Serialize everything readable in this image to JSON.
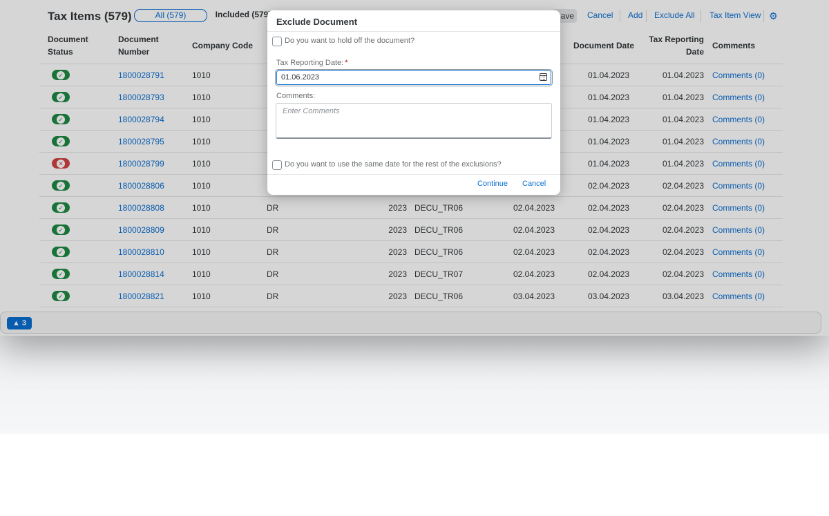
{
  "toolbar": {
    "title": "Tax Items (579)",
    "seg_all": "All (579)",
    "seg_included": "Included (579)",
    "save": "Save",
    "cancel": "Cancel",
    "add": "Add",
    "exclude_all": "Exclude All",
    "tax_item_view": "Tax Item View"
  },
  "columns": {
    "doc_status_1": "Document",
    "doc_status_2": "Status",
    "doc_number_1": "Document",
    "doc_number_2": "Number",
    "company_code": "Company Code",
    "document_date": "Document Date",
    "tax_reporting_1": "Tax Reporting",
    "tax_reporting_2": "Date",
    "comments": "Comments"
  },
  "rows": [
    {
      "status": "ok",
      "number": "1800028791",
      "company": "1010",
      "type": "",
      "year": "",
      "code": "",
      "posting": "",
      "doc_date": "01.04.2023",
      "tax_date": "01.04.2023",
      "comments": "Comments (0)"
    },
    {
      "status": "ok",
      "number": "1800028793",
      "company": "1010",
      "type": "",
      "year": "",
      "code": "",
      "posting": "",
      "doc_date": "01.04.2023",
      "tax_date": "01.04.2023",
      "comments": "Comments (0)"
    },
    {
      "status": "ok",
      "number": "1800028794",
      "company": "1010",
      "type": "",
      "year": "",
      "code": "",
      "posting": "",
      "doc_date": "01.04.2023",
      "tax_date": "01.04.2023",
      "comments": "Comments (0)"
    },
    {
      "status": "ok",
      "number": "1800028795",
      "company": "1010",
      "type": "",
      "year": "",
      "code": "",
      "posting": "",
      "doc_date": "01.04.2023",
      "tax_date": "01.04.2023",
      "comments": "Comments (0)"
    },
    {
      "status": "error",
      "number": "1800028799",
      "company": "1010",
      "type": "",
      "year": "",
      "code": "",
      "posting": "",
      "doc_date": "01.04.2023",
      "tax_date": "01.04.2023",
      "comments": "Comments (0)"
    },
    {
      "status": "ok",
      "number": "1800028806",
      "company": "1010",
      "type": "",
      "year": "",
      "code": "",
      "posting": "",
      "doc_date": "02.04.2023",
      "tax_date": "02.04.2023",
      "comments": "Comments (0)"
    },
    {
      "status": "ok",
      "number": "1800028808",
      "company": "1010",
      "type": "DR",
      "year": "2023",
      "code": "DECU_TR06",
      "posting": "02.04.2023",
      "doc_date": "02.04.2023",
      "tax_date": "02.04.2023",
      "comments": "Comments (0)"
    },
    {
      "status": "ok",
      "number": "1800028809",
      "company": "1010",
      "type": "DR",
      "year": "2023",
      "code": "DECU_TR06",
      "posting": "02.04.2023",
      "doc_date": "02.04.2023",
      "tax_date": "02.04.2023",
      "comments": "Comments (0)"
    },
    {
      "status": "ok",
      "number": "1800028810",
      "company": "1010",
      "type": "DR",
      "year": "2023",
      "code": "DECU_TR06",
      "posting": "02.04.2023",
      "doc_date": "02.04.2023",
      "tax_date": "02.04.2023",
      "comments": "Comments (0)"
    },
    {
      "status": "ok",
      "number": "1800028814",
      "company": "1010",
      "type": "DR",
      "year": "2023",
      "code": "DECU_TR07",
      "posting": "02.04.2023",
      "doc_date": "02.04.2023",
      "tax_date": "02.04.2023",
      "comments": "Comments (0)"
    },
    {
      "status": "ok",
      "number": "1800028821",
      "company": "1010",
      "type": "DR",
      "year": "2023",
      "code": "DECU_TR06",
      "posting": "03.04.2023",
      "doc_date": "03.04.2023",
      "tax_date": "03.04.2023",
      "comments": "Comments (0)"
    }
  ],
  "footer": {
    "warning_count": "3",
    "warning_icon": "warning-triangle-icon"
  },
  "dialog": {
    "title": "Exclude Document",
    "hold_off": "Do you want to hold off the document?",
    "date_label": "Tax Reporting Date:",
    "date_required": "*",
    "date_value": "01.06.2023",
    "comments_label": "Comments:",
    "comments_placeholder": "Enter Comments",
    "same_date": "Do you want to use the same date for the rest of the exclusions?",
    "continue": "Continue",
    "cancel": "Cancel"
  },
  "colors": {
    "accent": "#0a6ed1",
    "status_ok": "#1e8a44",
    "status_error": "#d04343"
  }
}
